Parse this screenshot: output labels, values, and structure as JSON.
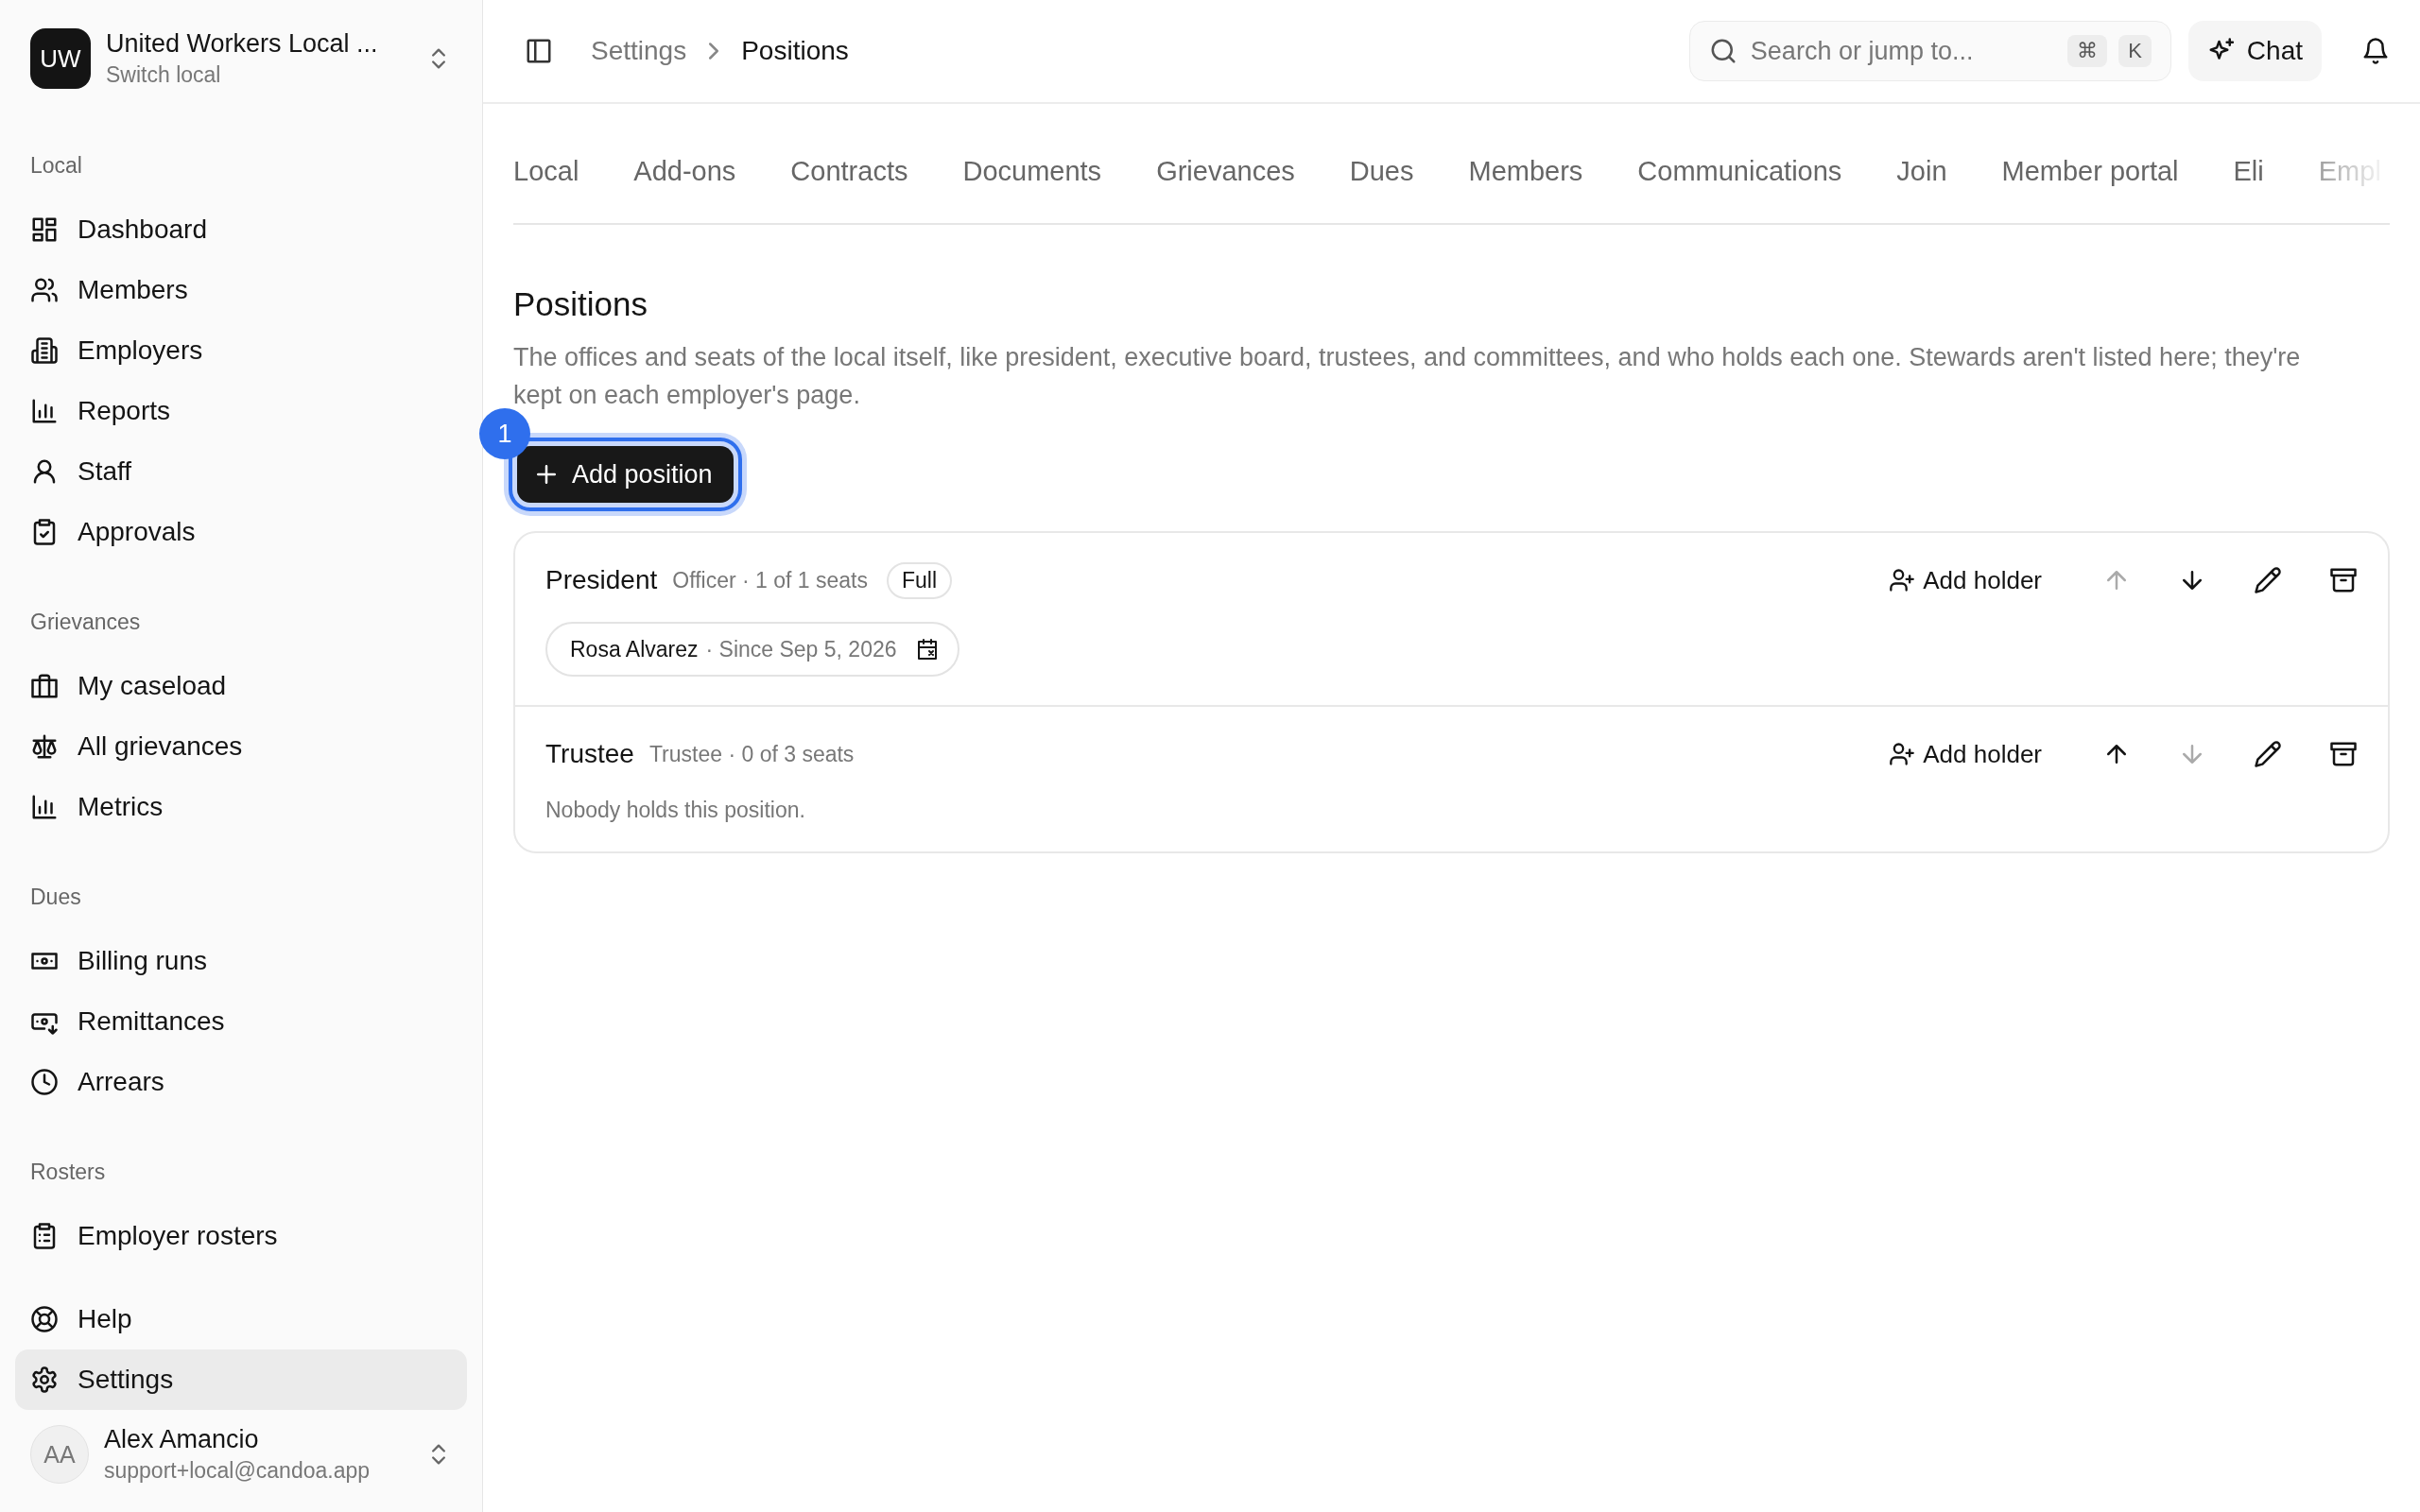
{
  "org": {
    "initials": "UW",
    "name": "United Workers Local ...",
    "subtitle": "Switch local"
  },
  "sidebar": {
    "sections": [
      {
        "label": "Local",
        "items": [
          {
            "label": "Dashboard",
            "selected": false
          },
          {
            "label": "Members",
            "selected": false
          },
          {
            "label": "Employers",
            "selected": false
          },
          {
            "label": "Reports",
            "selected": false
          },
          {
            "label": "Staff",
            "selected": false
          },
          {
            "label": "Approvals",
            "selected": false
          }
        ]
      },
      {
        "label": "Grievances",
        "items": [
          {
            "label": "My caseload",
            "selected": false
          },
          {
            "label": "All grievances",
            "selected": false
          },
          {
            "label": "Metrics",
            "selected": false
          }
        ]
      },
      {
        "label": "Dues",
        "items": [
          {
            "label": "Billing runs",
            "selected": false
          },
          {
            "label": "Remittances",
            "selected": false
          },
          {
            "label": "Arrears",
            "selected": false
          }
        ]
      },
      {
        "label": "Rosters",
        "items": [
          {
            "label": "Employer rosters",
            "selected": false
          }
        ]
      }
    ],
    "footer_items": [
      {
        "label": "Help",
        "selected": false
      },
      {
        "label": "Settings",
        "selected": true
      }
    ]
  },
  "user": {
    "initials": "AA",
    "name": "Alex Amancio",
    "email": "support+local@candoa.app"
  },
  "breadcrumb": [
    "Settings",
    "Positions"
  ],
  "search": {
    "placeholder": "Search or jump to...",
    "shortcut": [
      "⌘",
      "K"
    ]
  },
  "chat_button": "Chat",
  "tabs": [
    {
      "label": "Local",
      "selected": false
    },
    {
      "label": "Add-ons",
      "selected": false
    },
    {
      "label": "Contracts",
      "selected": false
    },
    {
      "label": "Documents",
      "selected": false
    },
    {
      "label": "Grievances",
      "selected": false
    },
    {
      "label": "Dues",
      "selected": false
    },
    {
      "label": "Members",
      "selected": false
    },
    {
      "label": "Communications",
      "selected": false
    },
    {
      "label": "Join",
      "selected": false
    },
    {
      "label": "Member portal",
      "selected": false
    },
    {
      "label": "Eli",
      "selected": false
    },
    {
      "label": "Empl",
      "selected": false
    }
  ],
  "page": {
    "title": "Positions",
    "description": "The offices and seats of the local itself, like president, executive board, trustees, and committees, and who holds each one. Stewards aren't listed here; they're kept on each employer's page."
  },
  "add_button": {
    "label": "Add position",
    "focused": true,
    "step": "1"
  },
  "positions": [
    {
      "name": "President",
      "meta": "Officer · 1 of 1 seats",
      "badge": "Full",
      "add_holder": "Add holder",
      "move_up_disabled": true,
      "move_down_disabled": false,
      "holders": [
        {
          "name": "Rosa Alvarez",
          "since": "· Since Sep 5, 2026"
        }
      ]
    },
    {
      "name": "Trustee",
      "meta": "Trustee · 0 of 3 seats",
      "add_holder": "Add holder",
      "move_up_disabled": false,
      "move_down_disabled": true,
      "empty_text": "Nobody holds this position."
    }
  ]
}
